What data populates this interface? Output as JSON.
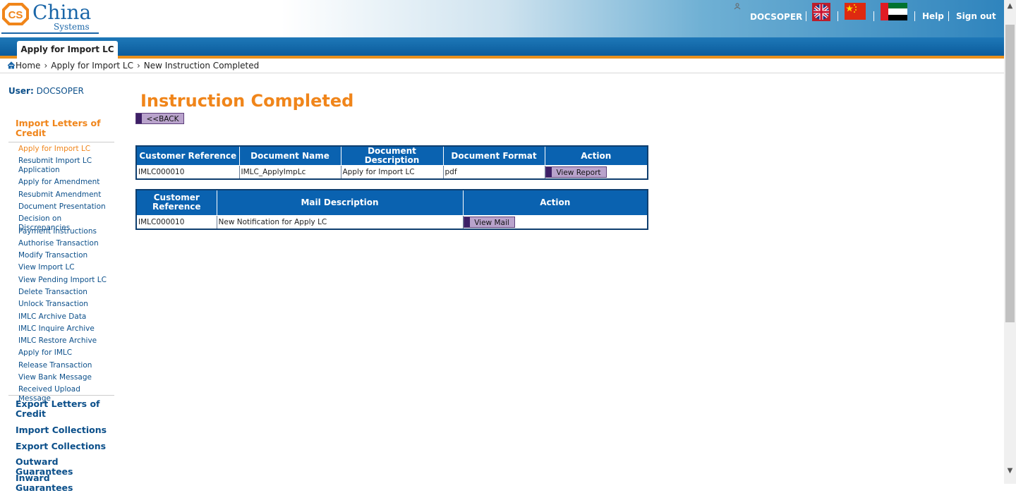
{
  "header": {
    "logo_brand": "China",
    "logo_sub": "Systems",
    "logo_badge": "CS",
    "username": "DOCSOPER",
    "help": "Help",
    "sign_out": "Sign out"
  },
  "tab": {
    "label": "Apply for Import LC"
  },
  "breadcrumb": {
    "home": "Home",
    "level1": "Apply for Import LC",
    "current": "New Instruction Completed",
    "chevron": "›"
  },
  "sidebar": {
    "user_label": "User:",
    "user_name": "DOCSOPER",
    "active_section": "Import Letters of Credit",
    "items": [
      "Apply for Import LC",
      "Resubmit Import LC Application",
      "Apply for Amendment",
      "Resubmit Amendment",
      "Document Presentation",
      "Decision on Discrepancies",
      "Payment Instructions",
      "Authorise Transaction",
      "Modify Transaction",
      "View Import LC",
      "View Pending Import LC",
      "Delete Transaction",
      "Unlock Transaction",
      "IMLC Archive Data",
      "IMLC Inquire Archive",
      "IMLC Restore Archive",
      "Apply for IMLC",
      "Release Transaction",
      "View Bank Message",
      "Received Upload Message"
    ],
    "sections": [
      "Export Letters of Credit",
      "Import Collections",
      "Export Collections",
      "Outward Guarantees",
      "Inward Guarantees"
    ]
  },
  "main": {
    "title": "Instruction Completed",
    "back_button": "<<BACK",
    "doc_table": {
      "headers": [
        "Customer Reference",
        "Document Name",
        "Document Description",
        "Document Format",
        "Action"
      ],
      "row": {
        "ref": "IMLC000010",
        "name": "IMLC_ApplyImpLc",
        "description": "Apply for Import LC",
        "format": "pdf"
      },
      "action_label": "View Report"
    },
    "mail_table": {
      "headers": [
        "Customer Reference",
        "Mail Description",
        "Action"
      ],
      "row": {
        "ref": "IMLC000010",
        "description": "New Notification for Apply LC"
      },
      "action_label": "View Mail"
    }
  },
  "colors": {
    "accent_orange": "#f0851a",
    "nav_blue": "#0b4f8a",
    "header_blue": "#0a62b0",
    "button_purple": "#b9a3cc"
  },
  "icons": [
    "home-icon",
    "user-icon",
    "uk-flag-icon",
    "china-flag-icon",
    "uae-flag-icon"
  ]
}
